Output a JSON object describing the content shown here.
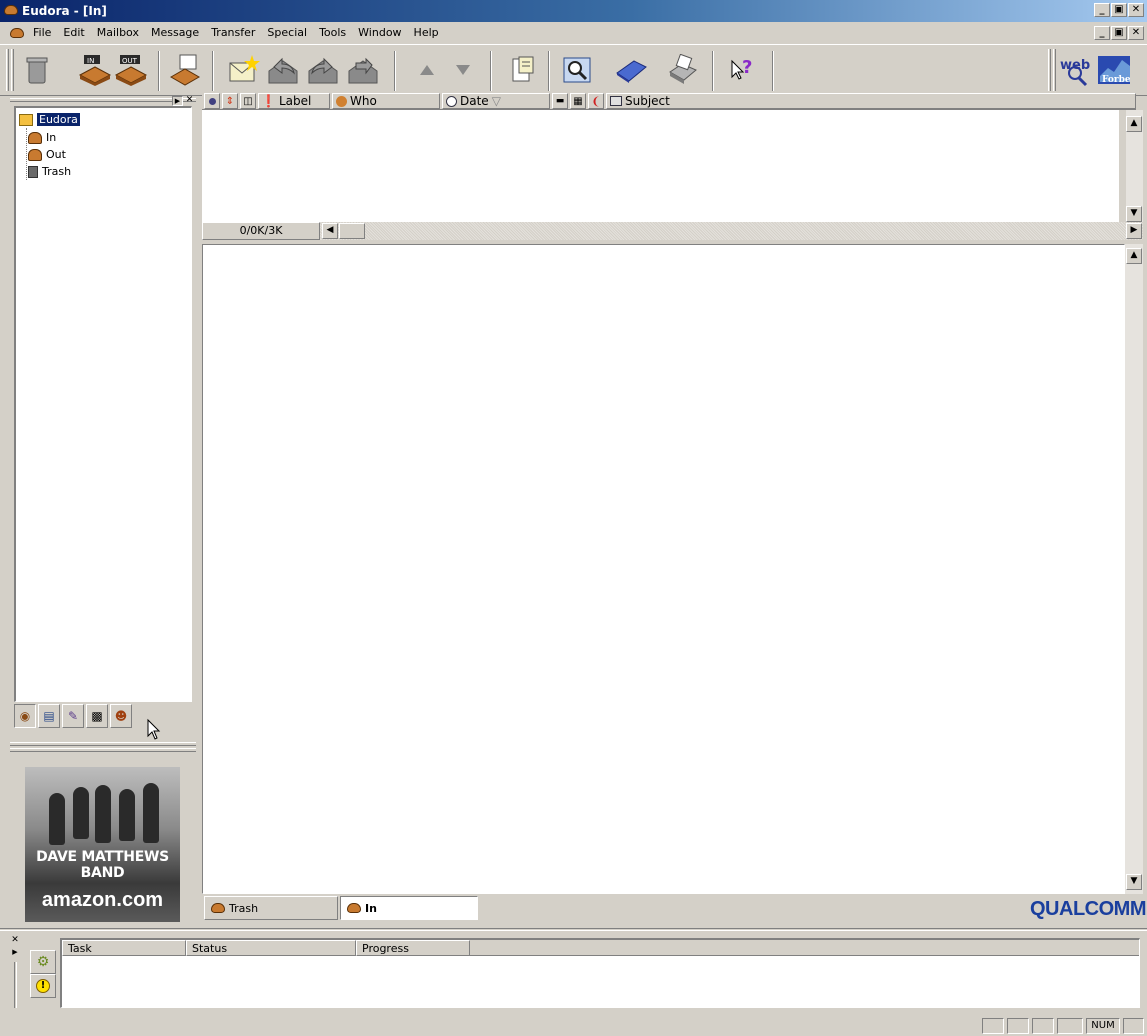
{
  "window": {
    "title": "Eudora - [In]"
  },
  "menu": [
    "File",
    "Edit",
    "Mailbox",
    "Message",
    "Transfer",
    "Special",
    "Tools",
    "Window",
    "Help"
  ],
  "toolbar": {
    "inbox_badge": "IN",
    "outbox_badge": "OUT",
    "web_label": "web",
    "forbes_label": "Forbes"
  },
  "tree": {
    "root": "Eudora",
    "items": [
      "In",
      "Out",
      "Trash"
    ]
  },
  "list_columns": {
    "label": "Label",
    "who": "Who",
    "date": "Date",
    "subject": "Subject"
  },
  "mailbox_size": "0/0K/3K",
  "mailbox_tabs": [
    {
      "label": "Trash",
      "active": false
    },
    {
      "label": "In",
      "active": true
    }
  ],
  "ad": {
    "band": "DAVE MATTHEWS BAND",
    "store": "amazon.com"
  },
  "brand": "QUALCOMM",
  "task_columns": [
    "Task",
    "Status",
    "Progress"
  ],
  "status_bar": {
    "num": "NUM"
  },
  "colors": {
    "title_gradient_start": "#0a246a",
    "title_gradient_end": "#a6caf0",
    "selection": "#0a246a",
    "qualcomm": "#1a3f9e"
  }
}
